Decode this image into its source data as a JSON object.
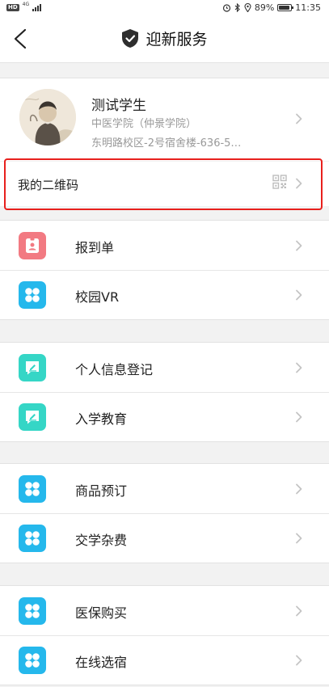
{
  "status_bar": {
    "badge": "HD",
    "network": "4G",
    "battery": "89%",
    "battery_level": 0.89,
    "time": "11:35"
  },
  "header": {
    "title": "迎新服务"
  },
  "profile": {
    "name": "测试学生",
    "college": "中医学院（仲景学院）",
    "address": "东明路校区-2号宿舍楼-636-5…"
  },
  "qr": {
    "label": "我的二维码"
  },
  "groups": [
    {
      "items": [
        {
          "label": "报到单",
          "icon": "id-card-icon"
        },
        {
          "label": "校园VR",
          "icon": "app-grid-icon"
        }
      ]
    },
    {
      "items": [
        {
          "label": "个人信息登记",
          "icon": "edit-note-icon"
        },
        {
          "label": "入学教育",
          "icon": "edit-note-icon"
        }
      ]
    },
    {
      "items": [
        {
          "label": "商品预订",
          "icon": "app-grid-icon"
        },
        {
          "label": "交学杂费",
          "icon": "app-grid-icon"
        }
      ]
    },
    {
      "items": [
        {
          "label": "医保购买",
          "icon": "app-grid-icon"
        },
        {
          "label": "在线选宿",
          "icon": "app-grid-icon"
        }
      ]
    }
  ],
  "colors": {
    "highlight": "#e8201d",
    "pink": "#f27a82",
    "blue": "#25b8ec",
    "teal": "#35d6c6"
  }
}
